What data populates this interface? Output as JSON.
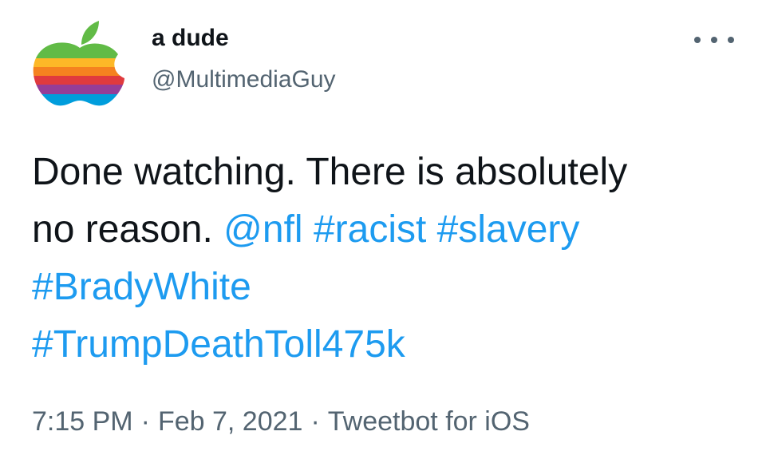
{
  "author": {
    "display_name": "a dude",
    "handle": "@MultimediaGuy",
    "avatar_icon": "rainbow-apple-logo-icon"
  },
  "menu": {
    "icon": "more-options-icon"
  },
  "tweet": {
    "text_line1": "Done watching. There is absolutely",
    "text_line2": "no reason.",
    "mention": "@nfl",
    "hashtags": [
      "#racist",
      "#slavery",
      "#BradyWhite",
      "#TrumpDeathToll475k"
    ]
  },
  "meta": {
    "time": "7:15 PM",
    "separator": "·",
    "date": "Feb 7, 2021",
    "source": "Tweetbot for iOS"
  },
  "colors": {
    "link": "#1d9bf0",
    "secondary_text": "#536471",
    "primary_text": "#0f1419",
    "leaf": "#61bb46",
    "stripe_yellow": "#fdb827",
    "stripe_orange": "#f5821f",
    "stripe_red": "#e03a3e",
    "stripe_purple": "#963d97",
    "stripe_blue": "#009ddc"
  }
}
